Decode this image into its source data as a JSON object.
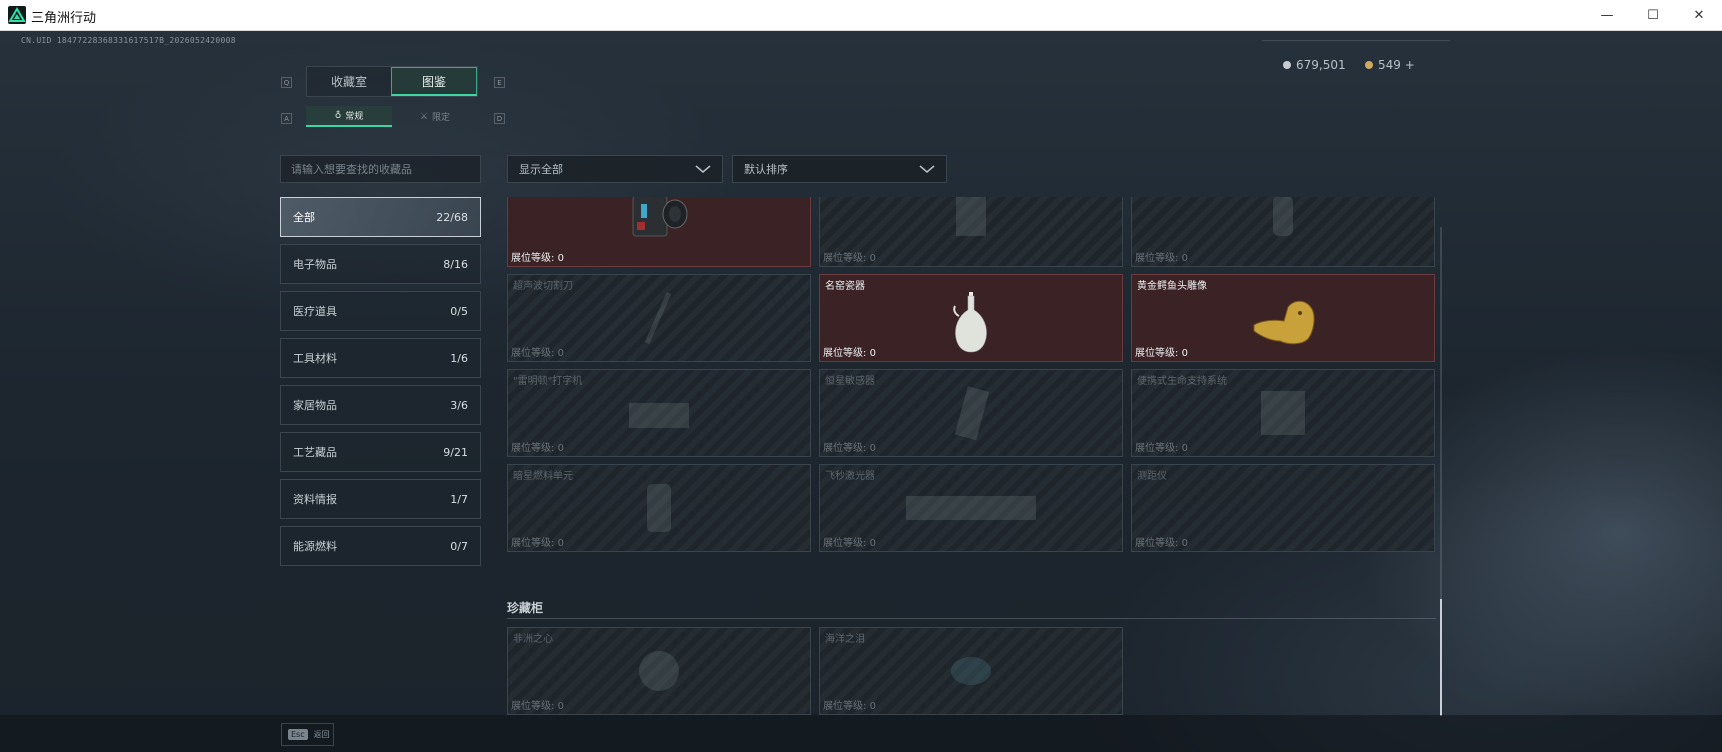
{
  "window": {
    "title": "三角洲行动",
    "minimize": "—",
    "maximize": "☐",
    "close": "✕"
  },
  "uid": "CN.UID 18477228368331617517B_2026052420008",
  "currency": {
    "coins": "679,501",
    "premium": "549 +",
    "coin_color": "#c8ccd0",
    "premium_color": "#d0a860"
  },
  "tabs": {
    "left_key": "Q",
    "right_key": "E",
    "items": [
      {
        "label": "收藏室"
      },
      {
        "label": "图鉴"
      }
    ]
  },
  "subtabs": {
    "left_key": "A",
    "right_key": "D",
    "items": [
      {
        "label": "常规"
      },
      {
        "label": "限定"
      }
    ]
  },
  "search": {
    "placeholder": "请输入想要查找的收藏品"
  },
  "categories": [
    {
      "label": "全部",
      "count": "22/68"
    },
    {
      "label": "电子物品",
      "count": "8/16"
    },
    {
      "label": "医疗道具",
      "count": "0/5"
    },
    {
      "label": "工具材料",
      "count": "1/6"
    },
    {
      "label": "家居物品",
      "count": "3/6"
    },
    {
      "label": "工艺藏品",
      "count": "9/21"
    },
    {
      "label": "资料情报",
      "count": "1/7"
    },
    {
      "label": "能源燃料",
      "count": "0/7"
    }
  ],
  "filters": {
    "show": "显示全部",
    "sort": "默认排序"
  },
  "level_label": "展位等级:",
  "cards": [
    {
      "name": "",
      "level": "0",
      "owned": true,
      "icon": "device-icon"
    },
    {
      "name": "",
      "level": "0",
      "owned": false,
      "icon": "device-icon"
    },
    {
      "name": "",
      "level": "0",
      "owned": false,
      "icon": "device-icon"
    },
    {
      "name": "超声波切割刀",
      "level": "0",
      "owned": false,
      "icon": "knife-icon"
    },
    {
      "name": "名窑瓷器",
      "level": "0",
      "owned": true,
      "icon": "vase-icon"
    },
    {
      "name": "黄金鳄鱼头雕像",
      "level": "0",
      "owned": true,
      "icon": "crocodile-icon"
    },
    {
      "name": "\"雷明顿\"打字机",
      "level": "0",
      "owned": false,
      "icon": "typewriter-icon"
    },
    {
      "name": "恒星敏感器",
      "level": "0",
      "owned": false,
      "icon": "sensor-icon"
    },
    {
      "name": "便携式生命支持系统",
      "level": "0",
      "owned": false,
      "icon": "lifesupport-icon"
    },
    {
      "name": "暗星燃料单元",
      "level": "0",
      "owned": false,
      "icon": "fuelcell-icon"
    },
    {
      "name": "飞秒激光器",
      "level": "0",
      "owned": false,
      "icon": "laser-icon"
    },
    {
      "name": "测距仪",
      "level": "0",
      "owned": false,
      "icon": "rangefinder-icon"
    }
  ],
  "section": {
    "title": "珍藏柜",
    "cards": [
      {
        "name": "非洲之心",
        "level": "0",
        "owned": false,
        "icon": "gem-icon"
      },
      {
        "name": "海洋之泪",
        "level": "0",
        "owned": false,
        "icon": "gem-icon"
      }
    ]
  },
  "bottom": {
    "key": "Esc",
    "label": "返回"
  }
}
